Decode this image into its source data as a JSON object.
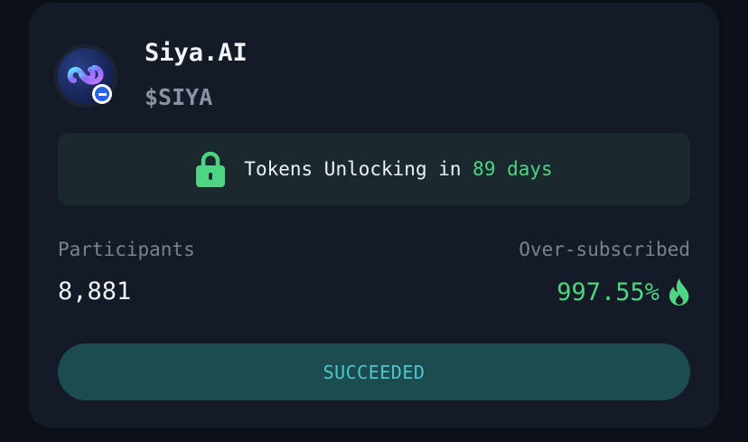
{
  "project": {
    "name": "Siya.AI",
    "ticker": "$SIYA",
    "logo_icon": "siya-logo-icon",
    "chain_badge_icon": "chain-badge-icon"
  },
  "unlock": {
    "icon": "lock-icon",
    "prefix": "Tokens Unlocking in",
    "days": "89 days"
  },
  "stats": {
    "participants_label": "Participants",
    "participants_value": "8,881",
    "oversubscribed_label": "Over-subscribed",
    "oversubscribed_value": "997.55%",
    "oversubscribed_icon": "fire-icon"
  },
  "status": {
    "label": "SUCCEEDED"
  },
  "colors": {
    "accent_green": "#4fd483",
    "status_teal": "#4cc6cc",
    "card_bg": "#141a26"
  }
}
